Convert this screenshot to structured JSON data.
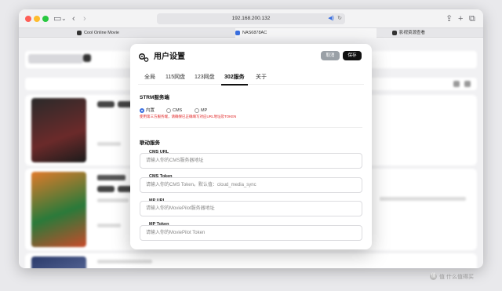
{
  "browser": {
    "address": "192.168.200.132",
    "tabs": [
      {
        "label": "Cool Online Movie"
      },
      {
        "label": "NAS6878AC"
      },
      {
        "label": "影视资源查看"
      }
    ]
  },
  "modal": {
    "title": "用户设置",
    "cancel_label": "取消",
    "save_label": "保存",
    "tabs": [
      "全局",
      "115网盘",
      "123网盘",
      "302服务",
      "关于"
    ],
    "active_tab": "302服务",
    "strm_section": {
      "title": "STRM服务端",
      "options": [
        "内置",
        "CMS",
        "MP"
      ],
      "selected": "内置",
      "warning": "使用第三方服务端，请确保已正确填写对应URL地址及TOKEN"
    },
    "link_section": {
      "title": "联动服务",
      "fields": [
        {
          "label": "CMS URL",
          "placeholder": "请输入你的CMS服务器地址"
        },
        {
          "label": "CMS Token",
          "placeholder": "请输入你的CMS Token。默认值：cloud_media_sync"
        },
        {
          "label": "MP URL",
          "placeholder": "请输入你的MoviePilot服务器地址"
        },
        {
          "label": "MP Token",
          "placeholder": "请输入你的MoviePilot Token"
        }
      ]
    }
  },
  "watermark": "值 什么值得买",
  "colors": {
    "accent": "#3a6fe0",
    "warning": "#e02020",
    "save_button": "#111111",
    "cancel_button": "#9aa0a6"
  }
}
